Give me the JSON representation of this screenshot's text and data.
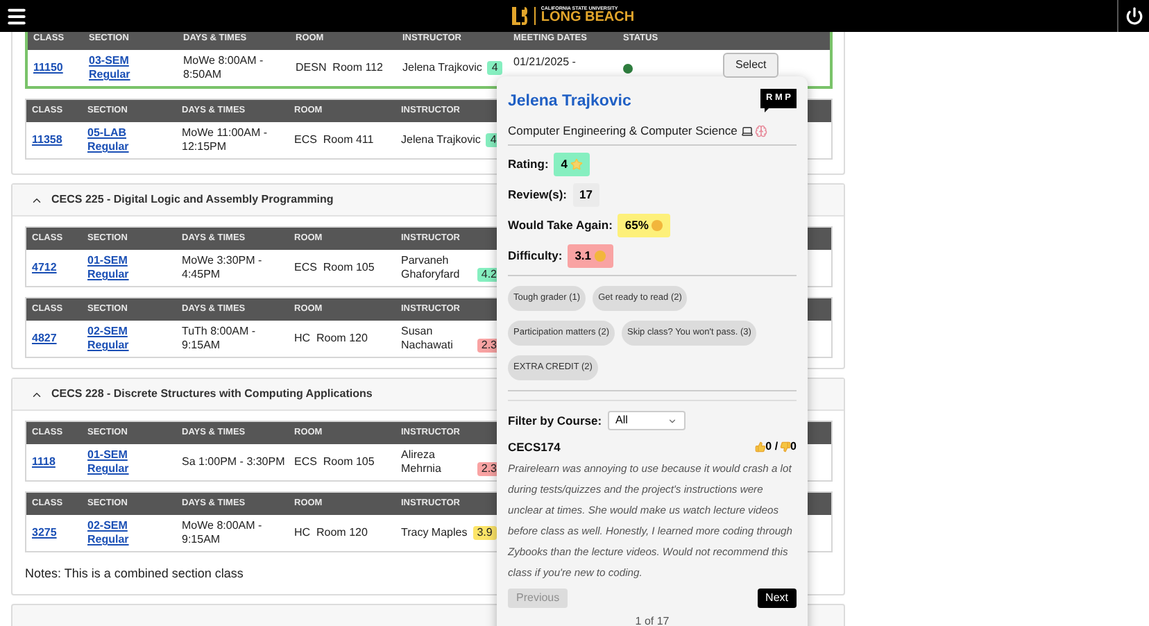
{
  "header": {
    "university": "CALIFORNIA STATE UNIVERSITY",
    "campus": "LONG BEACH"
  },
  "sections": [
    {
      "tables": [
        {
          "selected": true,
          "columns": [
            "CLASS",
            "SECTION",
            "DAYS & TIMES",
            "ROOM",
            "INSTRUCTOR",
            "MEETING DATES",
            "STATUS"
          ],
          "row": {
            "class": "11150",
            "section": "03-SEM Regular",
            "days": "MoWe 8:00AM - 8:50AM",
            "room": "DESN  Room 112",
            "instructor": "Jelena Trajkovic",
            "rating": "4",
            "color": "#86efc0",
            "dates": "01/21/2025 -",
            "status": {
              "color": "#2e7d3e"
            },
            "action": "Select"
          }
        },
        {
          "selected": false,
          "columns": [
            "CLASS",
            "SECTION",
            "DAYS & TIMES",
            "ROOM",
            "INSTRUCTOR"
          ],
          "row": {
            "class": "11358",
            "section": "05-LAB Regular",
            "days": "MoWe 11:00AM - 12:15PM",
            "room": "ECS  Room 411",
            "instructor": "Jelena Trajkovic",
            "rating": "4",
            "color": "#86efc0"
          }
        }
      ]
    },
    {
      "title": "CECS 225 - Digital Logic and Assembly Programming",
      "expanded": true,
      "tables": [
        {
          "selected": false,
          "columns": [
            "CLASS",
            "SECTION",
            "DAYS & TIMES",
            "ROOM",
            "INSTRUCTOR"
          ],
          "row": {
            "class": "4712",
            "section": "01-SEM Regular",
            "days": "MoWe 3:30PM - 4:45PM",
            "room": "ECS  Room 105",
            "instructor": "Parvaneh Ghaforyfard",
            "rating": "4.2",
            "color": "#86efc0"
          }
        },
        {
          "selected": false,
          "columns": [
            "CLASS",
            "SECTION",
            "DAYS & TIMES",
            "ROOM",
            "INSTRUCTOR"
          ],
          "row": {
            "class": "4827",
            "section": "02-SEM Regular",
            "days": "TuTh 8:00AM - 9:15AM",
            "room": "HC  Room 120",
            "instructor": "Susan Nachawati",
            "rating": "2.3",
            "color": "#f9a3a3"
          }
        }
      ]
    },
    {
      "title": "CECS 228 - Discrete Structures with Computing Applications",
      "expanded": true,
      "tables": [
        {
          "selected": false,
          "columns": [
            "CLASS",
            "SECTION",
            "DAYS & TIMES",
            "ROOM",
            "INSTRUCTOR"
          ],
          "row": {
            "class": "1118",
            "section": "01-SEM Regular",
            "days": "Sa 1:00PM - 3:30PM",
            "room": "ECS  Room 105",
            "instructor": "Alireza Mehrnia",
            "rating": "2.3",
            "color": "#f9a3a3"
          }
        },
        {
          "selected": false,
          "columns": [
            "CLASS",
            "SECTION",
            "DAYS & TIMES",
            "ROOM",
            "INSTRUCTOR"
          ],
          "row": {
            "class": "3275",
            "section": "02-SEM Regular",
            "days": "MoWe 8:00AM - 9:15AM",
            "room": "HC  Room 120",
            "instructor": "Tracy Maples",
            "rating": "3.9",
            "color": "#fde568"
          }
        }
      ],
      "notes": "Notes: This is a combined section class"
    }
  ],
  "popover": {
    "name": "Jelena Trajkovic",
    "badge": "R M P",
    "department": "Computer Engineering & Computer Science",
    "stats": [
      {
        "label": "Rating:",
        "value": "4",
        "color": "#86efc0",
        "kind": "star"
      },
      {
        "label": "Review(s):",
        "value": "17",
        "color": "#ebebeb",
        "kind": "none"
      },
      {
        "label": "Would Take Again:",
        "value": "65%",
        "color": "#fdf07a",
        "kind": "face"
      },
      {
        "label": "Difficulty:",
        "value": "3.1",
        "color": "#f9a3a3",
        "kind": "face"
      }
    ],
    "tags": [
      "Tough grader (1)",
      "Get ready to read (2)",
      "Participation matters (2)",
      "Skip class? You won't pass. (3)",
      "EXTRA CREDIT (2)"
    ],
    "filter": {
      "label": "Filter by Course:",
      "value": "All"
    },
    "review": {
      "course": "CECS174",
      "likes": "0 /",
      "dislikes": "0",
      "text": "Prairelearn was annoying to use because it would crash a lot during tests/quizzes and the project's instructions were unclear at times. She would make us watch lecture videos before class as well. Honestly, I learned more coding through Zybooks than the lecture videos. Would not recommend this class if you're new to coding."
    },
    "previous": {
      "label": "Previous",
      "disabled": true
    },
    "next": {
      "label": "Next",
      "disabled": false
    },
    "page": "1 of 17"
  }
}
